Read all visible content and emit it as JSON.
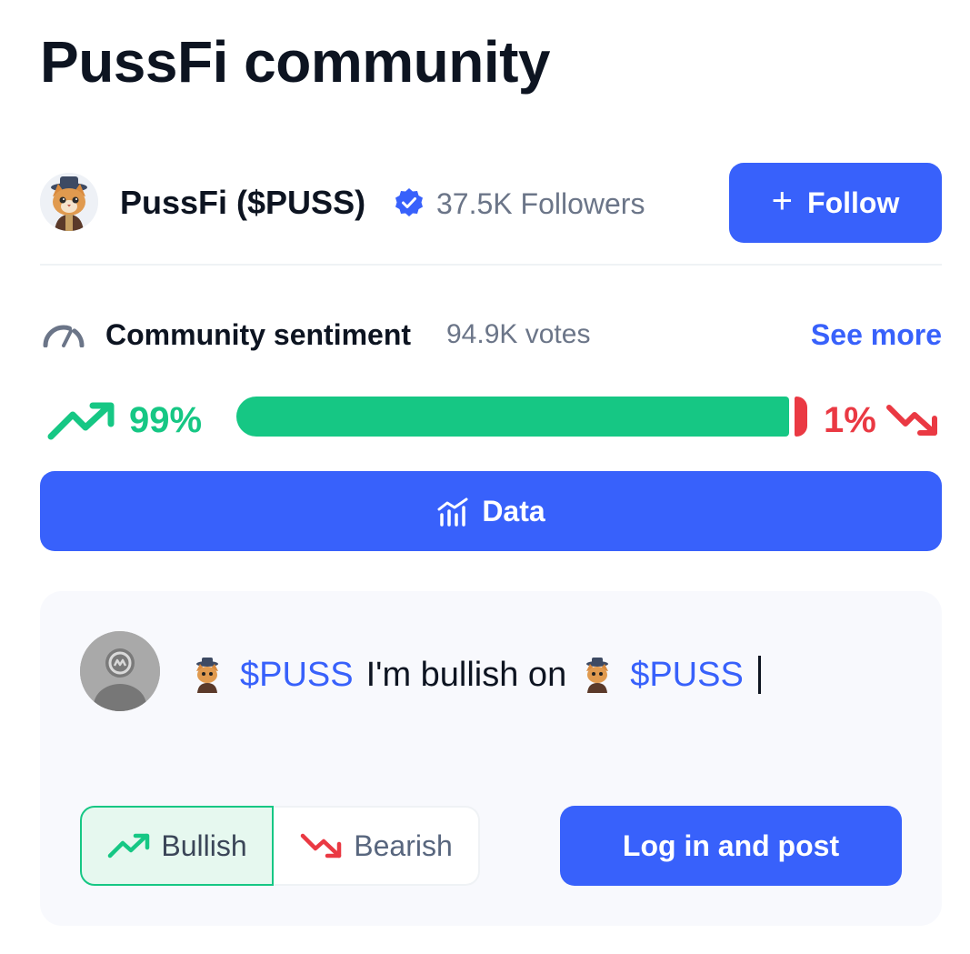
{
  "page": {
    "title": "PussFi community"
  },
  "coin": {
    "name": "PussFi ($PUSS)",
    "followers": "37.5K Followers",
    "follow_plus": "+",
    "follow_label": "Follow",
    "avatar_icon": "cat-mascot-icon",
    "verified_icon": "verified-badge-icon"
  },
  "sentiment": {
    "label": "Community sentiment",
    "votes": "94.9K votes",
    "see_more": "See more",
    "bullish_pct_text": "99%",
    "bearish_pct_text": "1%",
    "bullish_fraction": 0.99,
    "bearish_fraction": 0.01
  },
  "data_button": {
    "label": "Data",
    "icon": "chart-bars-icon"
  },
  "composer": {
    "tag1": "$PUSS",
    "text": "I'm bullish on",
    "tag2": "$PUSS",
    "avatar_icon": "coinmarketcap-user-avatar"
  },
  "toggle": {
    "bullish": "Bullish",
    "bearish": "Bearish",
    "selected": "Bullish"
  },
  "login_button": {
    "label": "Log in and post"
  },
  "colors": {
    "accent": "#3861fb",
    "bullish": "#16c784",
    "bearish": "#ea3943",
    "text": "#0d1421",
    "muted": "#6b7588"
  }
}
